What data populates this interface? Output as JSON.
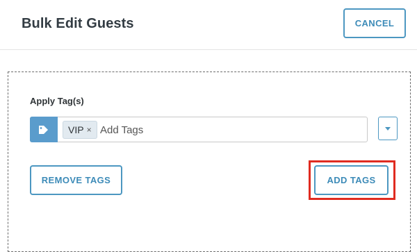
{
  "header": {
    "title": "Bulk Edit Guests",
    "cancel_label": "CANCEL"
  },
  "form": {
    "label": "Apply Tag(s)",
    "tag_icon": "tag-icon",
    "chips": [
      {
        "label": "VIP",
        "remove_glyph": "×"
      }
    ],
    "input_placeholder": "Add Tags",
    "dropdown_icon": "caret-down-icon"
  },
  "actions": {
    "remove_label": "REMOVE TAGS",
    "add_label": "ADD TAGS",
    "highlight_color": "#e02b20"
  },
  "colors": {
    "accent": "#4c97c1",
    "tag_icon_bg": "#5a9ccc",
    "title": "#333c43"
  }
}
